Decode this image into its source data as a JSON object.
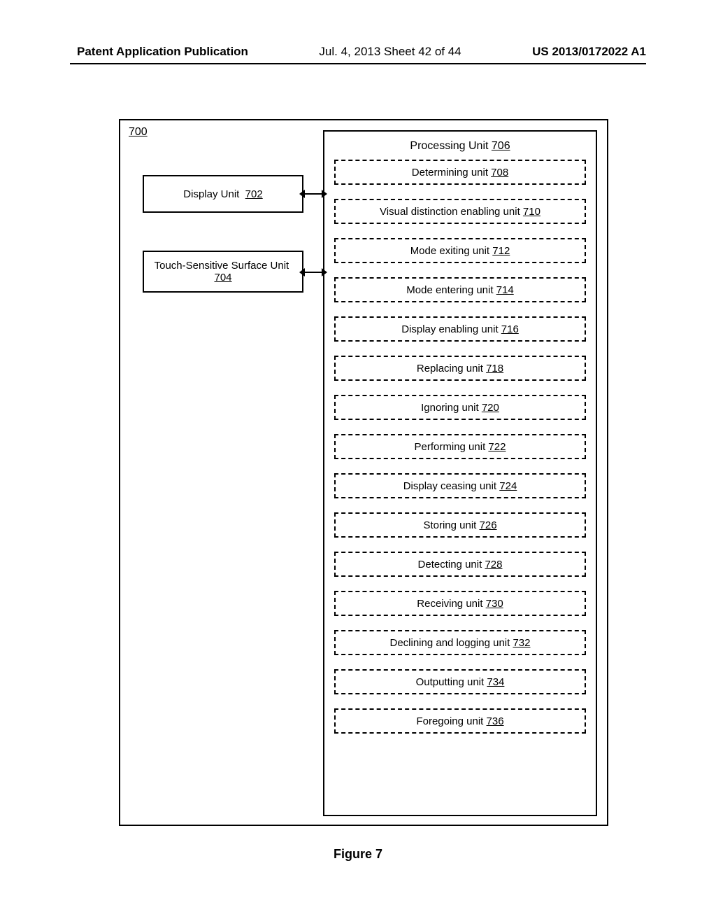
{
  "header": {
    "left": "Patent Application Publication",
    "mid": "Jul. 4, 2013   Sheet 42 of 44",
    "right": "US 2013/0172022 A1"
  },
  "figure": {
    "ref": "700",
    "caption": "Figure 7",
    "left_boxes": {
      "display": {
        "label": "Display Unit",
        "num": "702"
      },
      "touch": {
        "label": "Touch-Sensitive Surface Unit",
        "num": "704"
      }
    },
    "processing": {
      "title_label": "Processing Unit",
      "title_num": "706",
      "units": [
        {
          "label": "Determining unit",
          "num": "708"
        },
        {
          "label": "Visual distinction enabling unit",
          "num": "710"
        },
        {
          "label": "Mode exiting unit",
          "num": "712"
        },
        {
          "label": "Mode entering unit",
          "num": "714"
        },
        {
          "label": "Display enabling unit",
          "num": "716"
        },
        {
          "label": "Replacing unit",
          "num": "718"
        },
        {
          "label": "Ignoring unit",
          "num": "720"
        },
        {
          "label": "Performing unit",
          "num": "722"
        },
        {
          "label": "Display ceasing unit",
          "num": "724"
        },
        {
          "label": "Storing unit",
          "num": "726"
        },
        {
          "label": "Detecting unit",
          "num": "728"
        },
        {
          "label": "Receiving unit",
          "num": "730"
        },
        {
          "label": "Declining and logging unit",
          "num": "732"
        },
        {
          "label": "Outputting unit",
          "num": "734"
        },
        {
          "label": "Foregoing unit",
          "num": "736"
        }
      ]
    }
  }
}
